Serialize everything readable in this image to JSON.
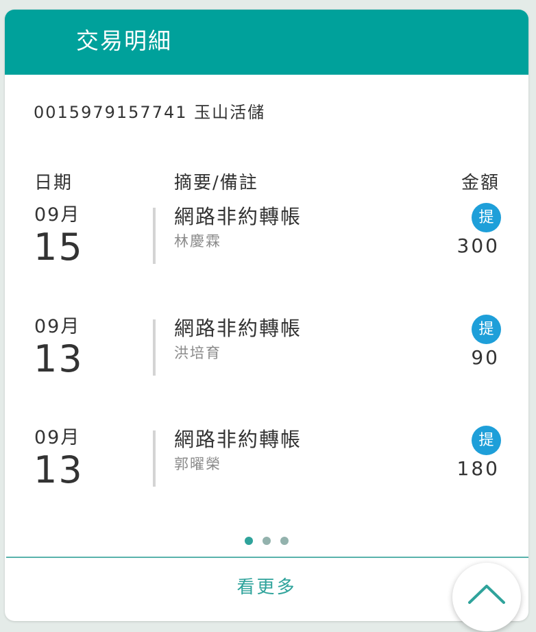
{
  "header": {
    "title": "交易明細"
  },
  "account": {
    "label": "0015979157741 玉山活儲"
  },
  "columns": {
    "date": "日期",
    "description": "摘要/備註",
    "amount": "金額"
  },
  "transactions": [
    {
      "month": "09月",
      "day": "15",
      "title": "網路非約轉帳",
      "note": "林慶霖",
      "type": "提",
      "amount": "300"
    },
    {
      "month": "09月",
      "day": "13",
      "title": "網路非約轉帳",
      "note": "洪培育",
      "type": "提",
      "amount": "90"
    },
    {
      "month": "09月",
      "day": "13",
      "title": "網路非約轉帳",
      "note": "郭曜榮",
      "type": "提",
      "amount": "180"
    }
  ],
  "pagination": {
    "total_pages": 3,
    "current_page": 1
  },
  "footer": {
    "more_label": "看更多"
  },
  "fab": {
    "icon": "chevron-up-icon"
  },
  "colors": {
    "brand": "#00a19b",
    "badge": "#1e9fd9",
    "link": "#2fa39b"
  }
}
